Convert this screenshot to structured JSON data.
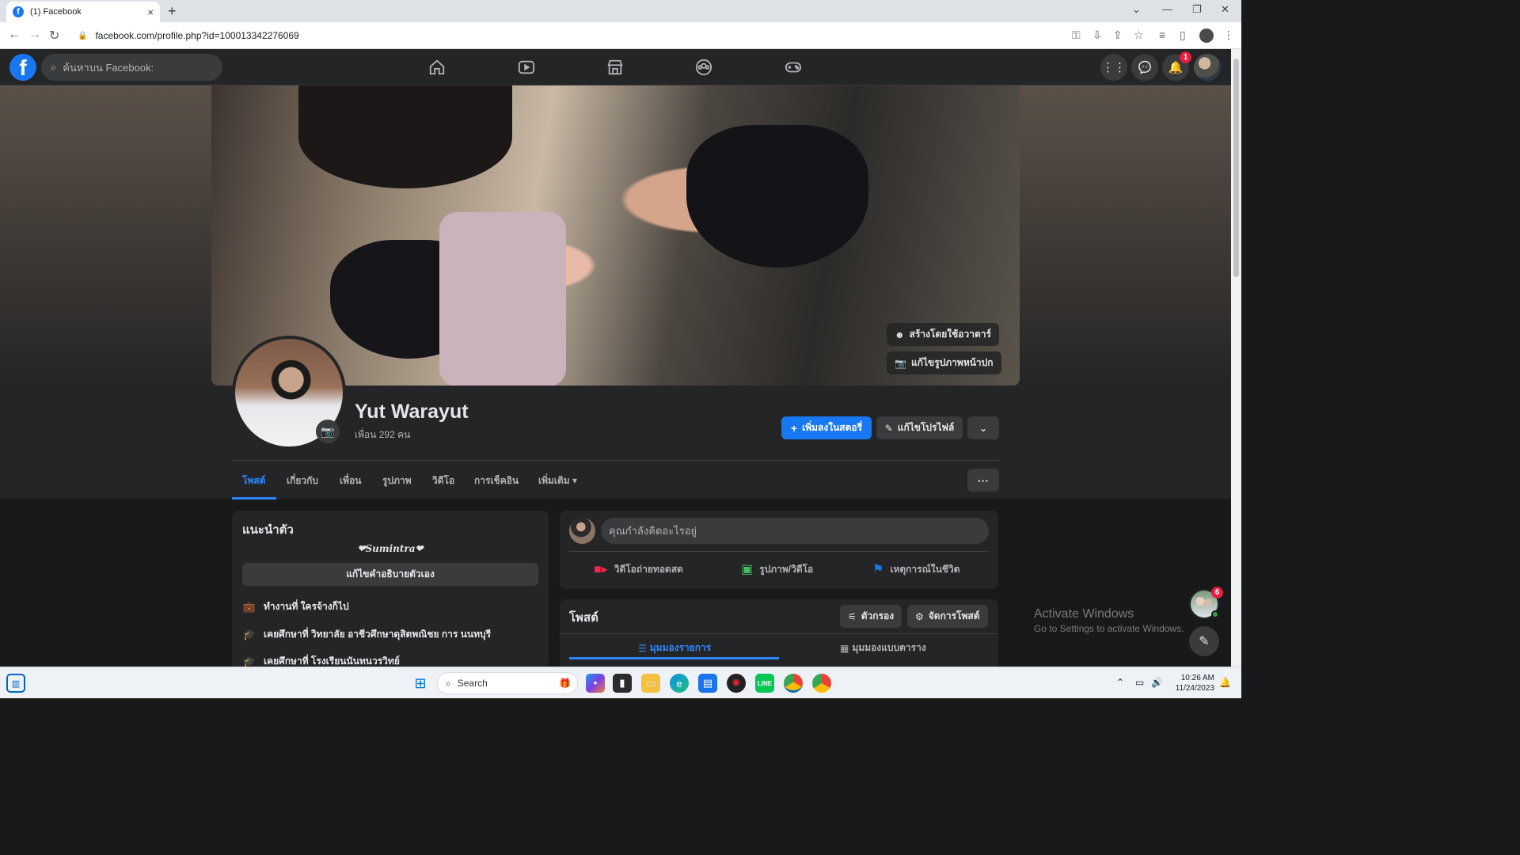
{
  "browser": {
    "tab_title": "(1) Facebook",
    "tab_close": "×",
    "new_tab": "+",
    "url": "facebook.com/profile.php?id=100013342276069"
  },
  "fb_nav": {
    "logo": "f",
    "search_placeholder": "ค้นหาบน Facebook:",
    "notification_count": "1",
    "icons": [
      "home-icon",
      "watch-icon",
      "marketplace-icon",
      "groups-icon",
      "gaming-icon",
      "menu-grid-icon",
      "messenger-icon",
      "notifications-icon"
    ]
  },
  "cover": {
    "avatar_button": "สร้างโดยใช้อวาตาร์",
    "edit_cover_button": "แก้ไขรูปภาพหน้าปก"
  },
  "profile": {
    "name": "Yut Warayut",
    "friends": "เพื่อน 292 คน",
    "add_story": "เพิ่มลงในสตอรี่",
    "edit_profile": "แก้ไขโปรไฟล์"
  },
  "profile_tabs": [
    {
      "label": "โพสต์"
    },
    {
      "label": "เกี่ยวกับ"
    },
    {
      "label": "เพื่อน"
    },
    {
      "label": "รูปภาพ"
    },
    {
      "label": "วิดีโอ"
    },
    {
      "label": "การเช็คอิน"
    },
    {
      "label": "เพิ่มเติม ▾"
    }
  ],
  "intro": {
    "title": "แนะนำตัว",
    "bio": "❤Sumintra❤",
    "edit_bio": "แก้ไขคำอธิบายตัวเอง",
    "items": [
      {
        "text": "ทำงานที่ ใครจ้างก็ไป",
        "icon": "work-icon"
      },
      {
        "text": "เคยศึกษาที่ วิทยาลัย อาชีวศึกษาดุสิตพณิชย การ นนทบุรี",
        "icon": "education-icon"
      },
      {
        "text": "เคยศึกษาที่ โรงเรียนนันทนวรวิทย์",
        "icon": "education-icon"
      }
    ]
  },
  "composer": {
    "placeholder": "คุณกำลังคิดอะไรอยู่",
    "live_video": "วิดีโอถ่ายทอดสด",
    "photo_video": "รูปภาพ/วิดีโอ",
    "life_event": "เหตุการณ์ในชีวิต"
  },
  "posts": {
    "title": "โพสต์",
    "filter": "ตัวกรอง",
    "manage": "จัดการโพสต์",
    "list_view": "มุมมองรายการ",
    "grid_view": "มุมมองแบบตาราง"
  },
  "chat": {
    "badge": "6"
  },
  "watermark": {
    "title": "Activate Windows",
    "subtitle": "Go to Settings to activate Windows."
  },
  "taskbar": {
    "search": "Search",
    "time": "10:26 AM",
    "date": "11/24/2023"
  },
  "colors": {
    "fb_blue": "#1877f2",
    "dark_bg": "#18191a",
    "card_bg": "#242526",
    "active_tab": "#2d88ff"
  }
}
